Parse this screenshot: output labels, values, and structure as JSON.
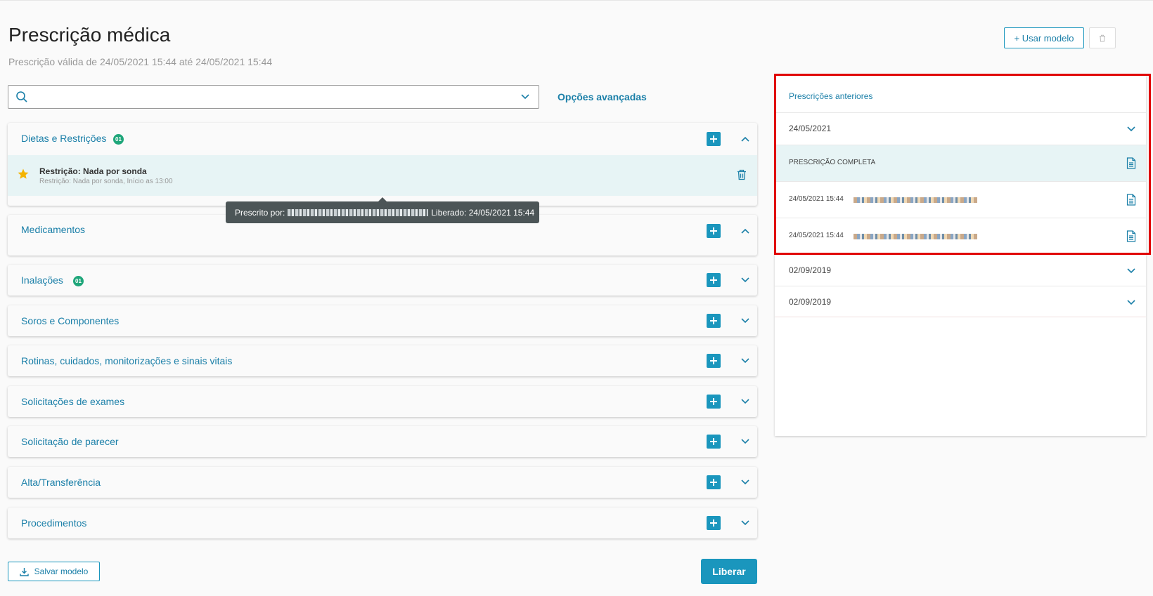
{
  "page": {
    "title": "Prescrição médica",
    "subtitle": "Prescrição válida de 24/05/2021 15:44 até 24/05/2021 15:44"
  },
  "toolbar": {
    "use_model_label": "+ Usar modelo"
  },
  "search": {
    "placeholder": "",
    "advanced_label": "Opções avançadas"
  },
  "sections": [
    {
      "title": "Dietas e Restrições",
      "badge": "01",
      "expanded": true
    },
    {
      "title": "Medicamentos",
      "badge": "",
      "expanded": true
    },
    {
      "title": "Inalações",
      "badge": "01",
      "expanded": false
    },
    {
      "title": "Soros e Componentes",
      "badge": "",
      "expanded": false
    },
    {
      "title": "Rotinas, cuidados, monitorizações e sinais vitais",
      "badge": "",
      "expanded": false
    },
    {
      "title": "Solicitações de exames",
      "badge": "",
      "expanded": false
    },
    {
      "title": "Solicitação de parecer",
      "badge": "",
      "expanded": false
    },
    {
      "title": "Alta/Transferência",
      "badge": "",
      "expanded": false
    },
    {
      "title": "Procedimentos",
      "badge": "",
      "expanded": false
    }
  ],
  "diet_item": {
    "title": "Restrição: Nada por sonda",
    "detail": "Restrição: Nada por sonda, Início as 13:00"
  },
  "tooltip": {
    "prescribed_by_label": "Prescrito por:",
    "released_label": "Liberado: 24/05/2021 15:44"
  },
  "footer": {
    "save_model_label": "Salvar modelo",
    "release_label": "Liberar"
  },
  "previous": {
    "title": "Prescrições anteriores",
    "groups": [
      {
        "date": "24/05/2021",
        "expanded": true
      },
      {
        "date": "02/09/2019",
        "expanded": false
      },
      {
        "date": "02/09/2019",
        "expanded": false
      }
    ],
    "complete_label": "PRESCRIÇÃO COMPLETA",
    "entries": [
      {
        "datetime": "24/05/2021 15:44"
      },
      {
        "datetime": "24/05/2021 15:44"
      }
    ]
  },
  "colors": {
    "accent": "#1a96bd",
    "link": "#1a7fa8",
    "badge": "#1fa67a",
    "highlight": "#e00000",
    "selected_row": "#e7f4f5"
  }
}
